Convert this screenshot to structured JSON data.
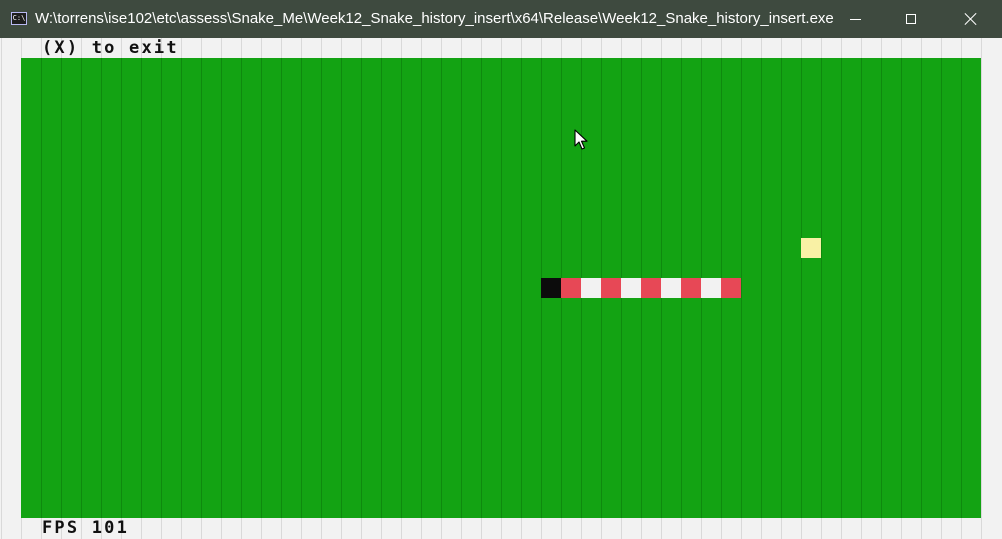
{
  "window": {
    "title": "W:\\torrens\\ise102\\etc\\assess\\Snake_Me\\Week12_Snake_history_insert\\x64\\Release\\Week12_Snake_history_insert.exe",
    "app_icon_glyph": "C:\\",
    "app_icon": "console-icon",
    "controls": {
      "minimize_icon": "minimize-icon",
      "maximize_icon": "maximize-icon",
      "close_icon": "close-icon"
    }
  },
  "hud": {
    "exit_hint": "(X) to exit",
    "fps_label": "FPS 101"
  },
  "board": {
    "columns": 48,
    "rows": 23,
    "background_color": "#13a313",
    "grid_line_color": "#0e8a0e",
    "frame_color": "#f2f2f2",
    "frame_line_color": "#d9d9d9"
  },
  "snake": {
    "head": {
      "col": 26,
      "row": 11
    },
    "segments": [
      {
        "col": 26,
        "row": 11,
        "color": "#0c0c0c"
      },
      {
        "col": 27,
        "row": 11,
        "color": "#e74856"
      },
      {
        "col": 28,
        "row": 11,
        "color": "#f2f2f2"
      },
      {
        "col": 29,
        "row": 11,
        "color": "#e74856"
      },
      {
        "col": 30,
        "row": 11,
        "color": "#f2f2f2"
      },
      {
        "col": 31,
        "row": 11,
        "color": "#e74856"
      },
      {
        "col": 32,
        "row": 11,
        "color": "#f2f2f2"
      },
      {
        "col": 33,
        "row": 11,
        "color": "#e74856"
      },
      {
        "col": 34,
        "row": 11,
        "color": "#f2f2f2"
      },
      {
        "col": 35,
        "row": 11,
        "color": "#e74856"
      }
    ]
  },
  "food": {
    "col": 39,
    "row": 9,
    "color": "#f9f1a5"
  },
  "cursor": {
    "icon": "mouse-pointer-icon"
  }
}
